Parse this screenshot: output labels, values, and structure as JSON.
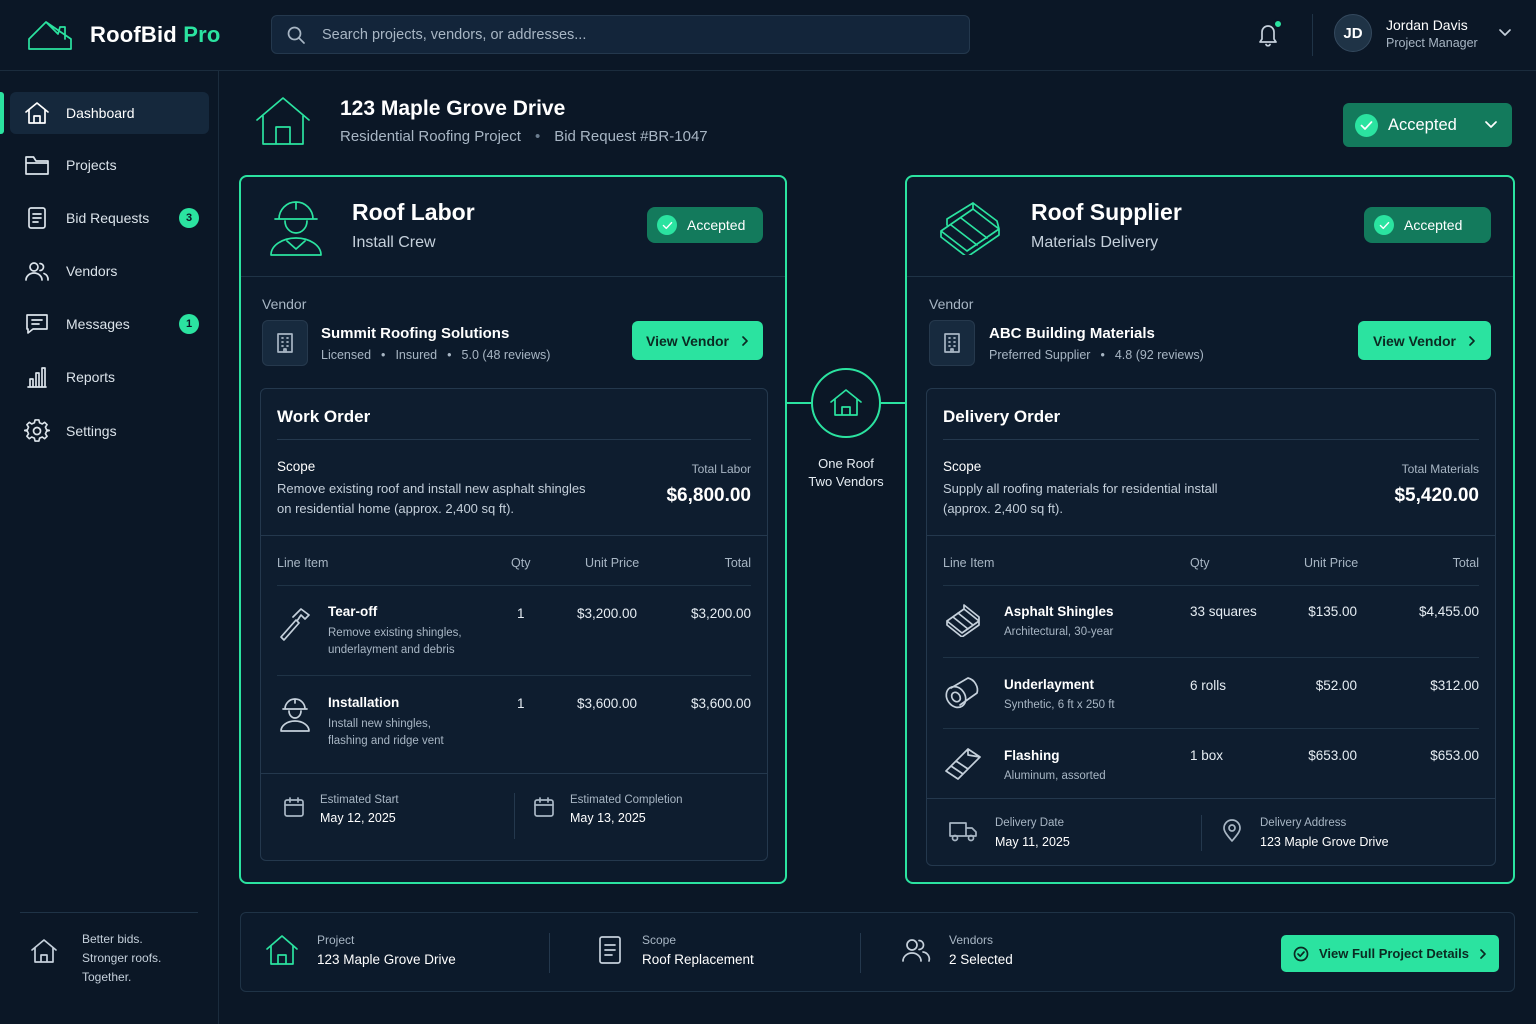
{
  "app": {
    "name_part1": "RoofBid",
    "name_part2": "Pro"
  },
  "search": {
    "placeholder": "Search projects, vendors, or addresses..."
  },
  "user": {
    "initials": "JD",
    "name": "Jordan Davis",
    "role": "Project Manager"
  },
  "sidebar": {
    "items": [
      {
        "label": "Dashboard",
        "icon": "home-icon",
        "active": true
      },
      {
        "label": "Projects",
        "icon": "folder-icon"
      },
      {
        "label": "Bid Requests",
        "icon": "document-icon",
        "badge": "3"
      },
      {
        "label": "Vendors",
        "icon": "users-icon"
      },
      {
        "label": "Messages",
        "icon": "message-icon",
        "badge": "1"
      },
      {
        "label": "Reports",
        "icon": "bar-chart-icon"
      },
      {
        "label": "Settings",
        "icon": "gear-icon"
      }
    ],
    "footer": {
      "line1": "Better bids.",
      "line2": "Stronger roofs.",
      "line3": "Together."
    }
  },
  "project": {
    "title": "123 Maple Grove Drive",
    "type": "Residential Roofing Project",
    "bid": "Bid Request #BR-1047",
    "status": "Accepted"
  },
  "labor": {
    "title": "Roof Labor",
    "subtitle": "Install Crew",
    "status": "Accepted",
    "vendor_label": "Vendor",
    "vendor_name": "Summit Roofing Solutions",
    "vendor_meta": [
      "Licensed",
      "Insured",
      "5.0 (48 reviews)"
    ],
    "view_btn": "View Vendor",
    "order_title": "Work Order",
    "scope_label": "Scope",
    "scope_line1": "Remove existing roof and install new asphalt shingles",
    "scope_line2": "on residential home (approx. 2,400 sq ft).",
    "total_label": "Total Labor",
    "total_value": "$6,800.00",
    "columns": [
      "Line Item",
      "Qty",
      "Unit Price",
      "Total"
    ],
    "rows": [
      {
        "icon": "hammer-icon",
        "name": "Tear-off",
        "desc1": "Remove existing shingles,",
        "desc2": "underlayment and debris",
        "qty": "1",
        "unit": "$3,200.00",
        "total": "$3,200.00"
      },
      {
        "icon": "worker-icon",
        "name": "Installation",
        "desc1": "Install new shingles,",
        "desc2": "flashing and ridge vent",
        "qty": "1",
        "unit": "$3,600.00",
        "total": "$3,600.00"
      }
    ],
    "footer": [
      {
        "label": "Estimated Start",
        "value": "May 12, 2025"
      },
      {
        "label": "Estimated Completion",
        "value": "May 13, 2025"
      }
    ]
  },
  "connector": {
    "line1": "One Roof",
    "line2": "Two Vendors"
  },
  "supplier": {
    "title": "Roof Supplier",
    "subtitle": "Materials Delivery",
    "status": "Accepted",
    "vendor_label": "Vendor",
    "vendor_name": "ABC Building Materials",
    "vendor_meta": [
      "Preferred Supplier",
      "4.8 (92 reviews)"
    ],
    "view_btn": "View Vendor",
    "order_title": "Delivery Order",
    "scope_label": "Scope",
    "scope_line1": "Supply all roofing materials for residential install",
    "scope_line2": "(approx. 2,400 sq ft).",
    "total_label": "Total Materials",
    "total_value": "$5,420.00",
    "columns": [
      "Line Item",
      "Qty",
      "Unit Price",
      "Total"
    ],
    "rows": [
      {
        "icon": "shingles-icon",
        "name": "Asphalt Shingles",
        "desc": "Architectural, 30-year",
        "qty": "33 squares",
        "unit": "$135.00",
        "total": "$4,455.00"
      },
      {
        "icon": "roll-icon",
        "name": "Underlayment",
        "desc": "Synthetic, 6 ft x 250 ft",
        "qty": "6 rolls",
        "unit": "$52.00",
        "total": "$312.00"
      },
      {
        "icon": "flashing-icon",
        "name": "Flashing",
        "desc": "Aluminum, assorted",
        "qty": "1 box",
        "unit": "$653.00",
        "total": "$653.00"
      }
    ],
    "footer": [
      {
        "label": "Delivery Date",
        "value": "May 11, 2025"
      },
      {
        "label": "Delivery Address",
        "value": "123 Maple Grove Drive"
      }
    ]
  },
  "bottom": {
    "items": [
      {
        "label": "Project",
        "value": "123 Maple Grove Drive"
      },
      {
        "label": "Scope",
        "value": "Roof Replacement"
      },
      {
        "label": "Vendors",
        "value": "2 Selected"
      }
    ],
    "button": "View Full Project Details"
  },
  "colors": {
    "accent": "#2be3a0",
    "accent_dark": "#137a5c",
    "background": "#0b1726"
  }
}
